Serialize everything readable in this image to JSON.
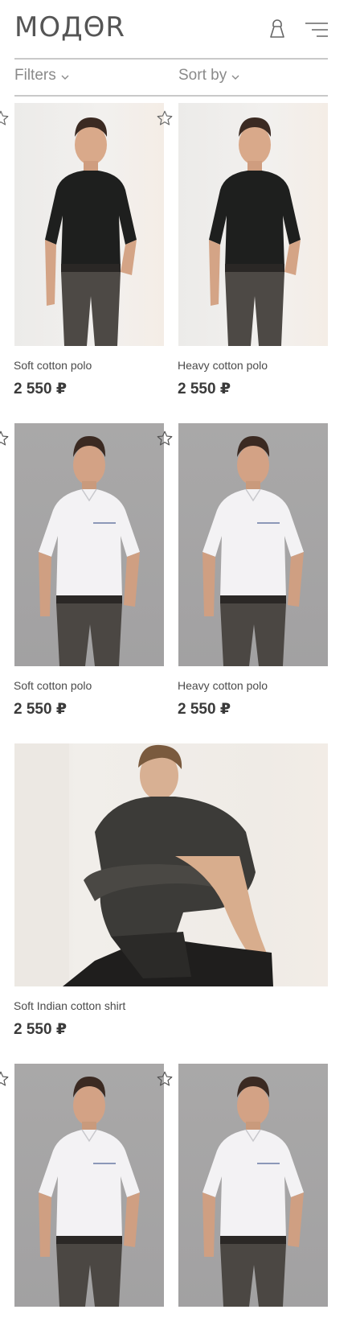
{
  "header": {
    "logo": "MOДΘR",
    "bag_icon": "shopping-bag-icon",
    "menu_icon": "hamburger-menu-icon"
  },
  "toolbar": {
    "filters_label": "Filters",
    "sort_label": "Sort by"
  },
  "products": [
    {
      "title": "Soft cotton polo",
      "price": "2 550 ₽",
      "shirt": "black"
    },
    {
      "title": "Heavy cotton polo",
      "price": "2 550 ₽",
      "shirt": "black"
    },
    {
      "title": "Soft cotton polo",
      "price": "2 550 ₽",
      "shirt": "white"
    },
    {
      "title": "Heavy cotton polo",
      "price": "2 550 ₽",
      "shirt": "white"
    },
    {
      "title": "Soft Indian cotton shirt",
      "price": "2 550 ₽",
      "shirt": "charcoal"
    },
    {
      "title": "",
      "price": "",
      "shirt": "white"
    },
    {
      "title": "",
      "price": "",
      "shirt": "white"
    }
  ],
  "colors": {
    "text": "#3a3a3a",
    "muted": "#8a8a8a",
    "divider": "#c9c9c9",
    "background": "#ffffff"
  }
}
